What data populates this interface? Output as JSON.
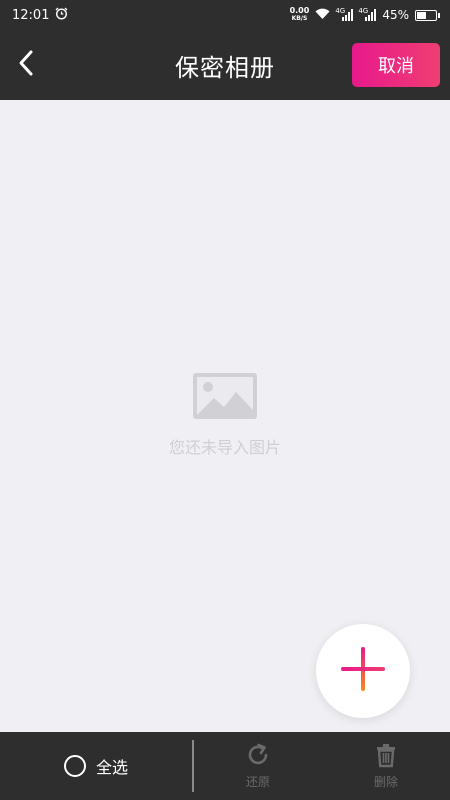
{
  "status_bar": {
    "time": "12:01",
    "net_speed_value": "0.00",
    "net_speed_unit": "KB/S",
    "signal_tag_1": "4G",
    "signal_tag_2": "4G",
    "battery_percent": "45%",
    "battery_level": 0.45,
    "icons": [
      "alarm-icon",
      "wifi-icon",
      "signal-icon",
      "signal-icon",
      "battery-icon"
    ]
  },
  "nav": {
    "title": "保密相册",
    "cancel_label": "取消",
    "back_icon": "chevron-left-icon"
  },
  "empty_state": {
    "message": "您还未导入图片",
    "icon": "image-placeholder-icon"
  },
  "fab": {
    "icon": "plus-icon"
  },
  "bottom_bar": {
    "select_all_label": "全选",
    "restore_label": "还原",
    "delete_label": "删除",
    "restore_icon": "refresh-icon",
    "delete_icon": "trash-icon"
  },
  "colors": {
    "bar_background": "#2e2e2e",
    "content_background": "#f0f0f4",
    "accent_gradient_start": "#e8198b",
    "accent_gradient_end": "#ee3e72",
    "disabled_text": "#6a6a6a",
    "empty_text": "#cfcfd4"
  }
}
